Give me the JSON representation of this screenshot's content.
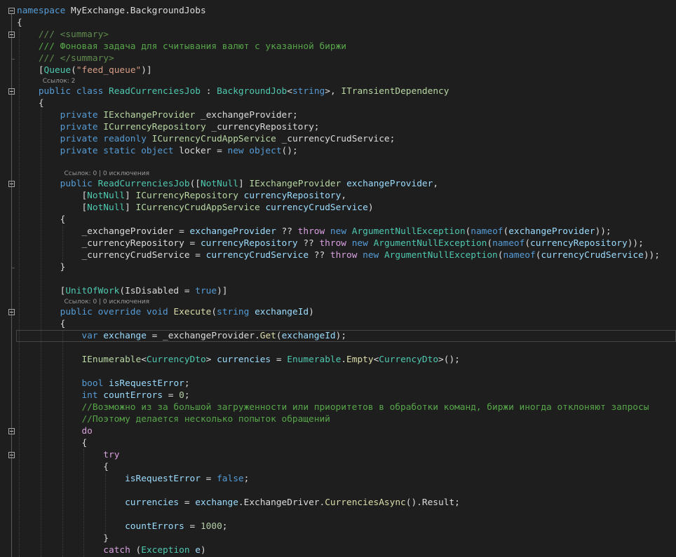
{
  "colors": {
    "background": "#1e1e1e",
    "keyword": "#569cd6",
    "control_keyword": "#d8a0df",
    "type": "#4ec9b0",
    "interface": "#b8d7a3",
    "comment": "#57a64a",
    "string": "#d69d85",
    "method": "#dcdcaa",
    "parameter": "#9cdcfe",
    "text": "#dcdcdc"
  },
  "code": {
    "lines": [
      [
        {
          "k": "kw",
          "t": "namespace"
        },
        {
          "k": "pl",
          "t": " MyExchange.BackgroundJobs"
        }
      ],
      [
        {
          "k": "pl",
          "t": "{"
        }
      ],
      [
        {
          "k": "pl",
          "t": "    "
        },
        {
          "k": "doc",
          "t": "/// <summary>"
        }
      ],
      [
        {
          "k": "pl",
          "t": "    "
        },
        {
          "k": "cm",
          "t": "/// Фоновая задача для считывания валют с указанной биржи"
        }
      ],
      [
        {
          "k": "pl",
          "t": "    "
        },
        {
          "k": "doc",
          "t": "/// </summary>"
        }
      ],
      [
        {
          "k": "pl",
          "t": "    ["
        },
        {
          "k": "ty",
          "t": "Queue"
        },
        {
          "k": "pl",
          "t": "("
        },
        {
          "k": "str",
          "t": "\"feed_queue\""
        },
        {
          "k": "pl",
          "t": ")]"
        }
      ],
      [
        {
          "k": "pl",
          "t": "    "
        },
        {
          "k": "kw",
          "t": "public class"
        },
        {
          "k": "pl",
          "t": " "
        },
        {
          "k": "ty",
          "t": "ReadCurrenciesJob"
        },
        {
          "k": "pl",
          "t": " : "
        },
        {
          "k": "ty",
          "t": "BackgroundJob"
        },
        {
          "k": "pl",
          "t": "<"
        },
        {
          "k": "kw",
          "t": "string"
        },
        {
          "k": "pl",
          "t": ">, "
        },
        {
          "k": "iface",
          "t": "ITransientDependency"
        }
      ],
      [
        {
          "k": "pl",
          "t": "    {"
        }
      ],
      [
        {
          "k": "pl",
          "t": "        "
        },
        {
          "k": "kw",
          "t": "private"
        },
        {
          "k": "pl",
          "t": " "
        },
        {
          "k": "iface",
          "t": "IExchangeProvider"
        },
        {
          "k": "pl",
          "t": " _exchangeProvider;"
        }
      ],
      [
        {
          "k": "pl",
          "t": "        "
        },
        {
          "k": "kw",
          "t": "private"
        },
        {
          "k": "pl",
          "t": " "
        },
        {
          "k": "iface",
          "t": "ICurrencyRepository"
        },
        {
          "k": "pl",
          "t": " _currencyRepository;"
        }
      ],
      [
        {
          "k": "pl",
          "t": "        "
        },
        {
          "k": "kw",
          "t": "private readonly"
        },
        {
          "k": "pl",
          "t": " "
        },
        {
          "k": "iface",
          "t": "ICurrencyCrudAppService"
        },
        {
          "k": "pl",
          "t": " _currencyCrudService;"
        }
      ],
      [
        {
          "k": "pl",
          "t": "        "
        },
        {
          "k": "kw",
          "t": "private static object"
        },
        {
          "k": "pl",
          "t": " locker = "
        },
        {
          "k": "kw",
          "t": "new object"
        },
        {
          "k": "pl",
          "t": "();"
        }
      ],
      [],
      [
        {
          "k": "pl",
          "t": "        "
        },
        {
          "k": "kw",
          "t": "public"
        },
        {
          "k": "pl",
          "t": " "
        },
        {
          "k": "ty",
          "t": "ReadCurrenciesJob"
        },
        {
          "k": "pl",
          "t": "(["
        },
        {
          "k": "ty",
          "t": "NotNull"
        },
        {
          "k": "pl",
          "t": "] "
        },
        {
          "k": "iface",
          "t": "IExchangeProvider"
        },
        {
          "k": "pl",
          "t": " "
        },
        {
          "k": "prm",
          "t": "exchangeProvider"
        },
        {
          "k": "pl",
          "t": ","
        }
      ],
      [
        {
          "k": "pl",
          "t": "            ["
        },
        {
          "k": "ty",
          "t": "NotNull"
        },
        {
          "k": "pl",
          "t": "] "
        },
        {
          "k": "iface",
          "t": "ICurrencyRepository"
        },
        {
          "k": "pl",
          "t": " "
        },
        {
          "k": "prm",
          "t": "currencyRepository"
        },
        {
          "k": "pl",
          "t": ","
        }
      ],
      [
        {
          "k": "pl",
          "t": "            ["
        },
        {
          "k": "ty",
          "t": "NotNull"
        },
        {
          "k": "pl",
          "t": "] "
        },
        {
          "k": "iface",
          "t": "ICurrencyCrudAppService"
        },
        {
          "k": "pl",
          "t": " "
        },
        {
          "k": "prm",
          "t": "currencyCrudService"
        },
        {
          "k": "pl",
          "t": ")"
        }
      ],
      [
        {
          "k": "pl",
          "t": "        {"
        }
      ],
      [
        {
          "k": "pl",
          "t": "            _exchangeProvider = "
        },
        {
          "k": "prm",
          "t": "exchangeProvider"
        },
        {
          "k": "pl",
          "t": " ?? "
        },
        {
          "k": "ctl",
          "t": "throw"
        },
        {
          "k": "pl",
          "t": " "
        },
        {
          "k": "kw",
          "t": "new"
        },
        {
          "k": "pl",
          "t": " "
        },
        {
          "k": "ty",
          "t": "ArgumentNullException"
        },
        {
          "k": "pl",
          "t": "("
        },
        {
          "k": "kw",
          "t": "nameof"
        },
        {
          "k": "pl",
          "t": "("
        },
        {
          "k": "prm",
          "t": "exchangeProvider"
        },
        {
          "k": "pl",
          "t": "));"
        }
      ],
      [
        {
          "k": "pl",
          "t": "            _currencyRepository = "
        },
        {
          "k": "prm",
          "t": "currencyRepository"
        },
        {
          "k": "pl",
          "t": " ?? "
        },
        {
          "k": "ctl",
          "t": "throw"
        },
        {
          "k": "pl",
          "t": " "
        },
        {
          "k": "kw",
          "t": "new"
        },
        {
          "k": "pl",
          "t": " "
        },
        {
          "k": "ty",
          "t": "ArgumentNullException"
        },
        {
          "k": "pl",
          "t": "("
        },
        {
          "k": "kw",
          "t": "nameof"
        },
        {
          "k": "pl",
          "t": "("
        },
        {
          "k": "prm",
          "t": "currencyRepository"
        },
        {
          "k": "pl",
          "t": "));"
        }
      ],
      [
        {
          "k": "pl",
          "t": "            _currencyCrudService = "
        },
        {
          "k": "prm",
          "t": "currencyCrudService"
        },
        {
          "k": "pl",
          "t": " ?? "
        },
        {
          "k": "ctl",
          "t": "throw"
        },
        {
          "k": "pl",
          "t": " "
        },
        {
          "k": "kw",
          "t": "new"
        },
        {
          "k": "pl",
          "t": " "
        },
        {
          "k": "ty",
          "t": "ArgumentNullException"
        },
        {
          "k": "pl",
          "t": "("
        },
        {
          "k": "kw",
          "t": "nameof"
        },
        {
          "k": "pl",
          "t": "("
        },
        {
          "k": "prm",
          "t": "currencyCrudService"
        },
        {
          "k": "pl",
          "t": "));"
        }
      ],
      [
        {
          "k": "pl",
          "t": "        }"
        }
      ],
      [],
      [
        {
          "k": "pl",
          "t": "        ["
        },
        {
          "k": "ty",
          "t": "UnitOfWork"
        },
        {
          "k": "pl",
          "t": "(IsDisabled = "
        },
        {
          "k": "kw",
          "t": "true"
        },
        {
          "k": "pl",
          "t": ")]"
        }
      ],
      [
        {
          "k": "pl",
          "t": "        "
        },
        {
          "k": "kw",
          "t": "public override void"
        },
        {
          "k": "pl",
          "t": " "
        },
        {
          "k": "fn",
          "t": "Execute"
        },
        {
          "k": "pl",
          "t": "("
        },
        {
          "k": "kw",
          "t": "string"
        },
        {
          "k": "pl",
          "t": " "
        },
        {
          "k": "prm",
          "t": "exchangeId"
        },
        {
          "k": "pl",
          "t": ")"
        }
      ],
      [
        {
          "k": "pl",
          "t": "        {"
        }
      ],
      [
        {
          "k": "pl",
          "t": "            "
        },
        {
          "k": "kw",
          "t": "var"
        },
        {
          "k": "pl",
          "t": " "
        },
        {
          "k": "prm",
          "t": "exchange"
        },
        {
          "k": "pl",
          "t": " = _exchangeProvider."
        },
        {
          "k": "fn",
          "t": "Get"
        },
        {
          "k": "pl",
          "t": "("
        },
        {
          "k": "prm",
          "t": "exchangeId"
        },
        {
          "k": "pl",
          "t": ");"
        }
      ],
      [],
      [
        {
          "k": "pl",
          "t": "            "
        },
        {
          "k": "iface",
          "t": "IEnumerable"
        },
        {
          "k": "pl",
          "t": "<"
        },
        {
          "k": "ty",
          "t": "CurrencyDto"
        },
        {
          "k": "pl",
          "t": "> "
        },
        {
          "k": "prm",
          "t": "currencies"
        },
        {
          "k": "pl",
          "t": " = "
        },
        {
          "k": "ty",
          "t": "Enumerable"
        },
        {
          "k": "pl",
          "t": "."
        },
        {
          "k": "fn",
          "t": "Empty"
        },
        {
          "k": "pl",
          "t": "<"
        },
        {
          "k": "ty",
          "t": "CurrencyDto"
        },
        {
          "k": "pl",
          "t": ">();"
        }
      ],
      [],
      [
        {
          "k": "pl",
          "t": "            "
        },
        {
          "k": "kw",
          "t": "bool"
        },
        {
          "k": "pl",
          "t": " "
        },
        {
          "k": "prm",
          "t": "isRequestError"
        },
        {
          "k": "pl",
          "t": ";"
        }
      ],
      [
        {
          "k": "pl",
          "t": "            "
        },
        {
          "k": "kw",
          "t": "int"
        },
        {
          "k": "pl",
          "t": " "
        },
        {
          "k": "prm",
          "t": "countErrors"
        },
        {
          "k": "pl",
          "t": " = "
        },
        {
          "k": "num",
          "t": "0"
        },
        {
          "k": "pl",
          "t": ";"
        }
      ],
      [
        {
          "k": "pl",
          "t": "            "
        },
        {
          "k": "cm",
          "t": "//Возможно из за большой загруженности или приоритетов в обработки команд, биржи иногда отклоняют запросы"
        }
      ],
      [
        {
          "k": "pl",
          "t": "            "
        },
        {
          "k": "cm",
          "t": "//Поэтому делается несколько попыток обращений"
        }
      ],
      [
        {
          "k": "pl",
          "t": "            "
        },
        {
          "k": "ctl",
          "t": "do"
        }
      ],
      [
        {
          "k": "pl",
          "t": "            {"
        }
      ],
      [
        {
          "k": "pl",
          "t": "                "
        },
        {
          "k": "ctl",
          "t": "try"
        }
      ],
      [
        {
          "k": "pl",
          "t": "                {"
        }
      ],
      [
        {
          "k": "pl",
          "t": "                    "
        },
        {
          "k": "prm",
          "t": "isRequestError"
        },
        {
          "k": "pl",
          "t": " = "
        },
        {
          "k": "kw",
          "t": "false"
        },
        {
          "k": "pl",
          "t": ";"
        }
      ],
      [],
      [
        {
          "k": "pl",
          "t": "                    "
        },
        {
          "k": "prm",
          "t": "currencies"
        },
        {
          "k": "pl",
          "t": " = "
        },
        {
          "k": "prm",
          "t": "exchange"
        },
        {
          "k": "pl",
          "t": ".ExchangeDriver."
        },
        {
          "k": "fn",
          "t": "CurrenciesAsync"
        },
        {
          "k": "pl",
          "t": "().Result;"
        }
      ],
      [],
      [
        {
          "k": "pl",
          "t": "                    "
        },
        {
          "k": "prm",
          "t": "countErrors"
        },
        {
          "k": "pl",
          "t": " = "
        },
        {
          "k": "num",
          "t": "1000"
        },
        {
          "k": "pl",
          "t": ";"
        }
      ],
      [
        {
          "k": "pl",
          "t": "                }"
        }
      ],
      [
        {
          "k": "pl",
          "t": "                "
        },
        {
          "k": "ctl",
          "t": "catch"
        },
        {
          "k": "pl",
          "t": " ("
        },
        {
          "k": "ty",
          "t": "Exception"
        },
        {
          "k": "pl",
          "t": " "
        },
        {
          "k": "prm",
          "t": "e"
        },
        {
          "k": "pl",
          "t": ")"
        }
      ]
    ],
    "codelens": [
      {
        "line": 6,
        "text": "Ссылок: 2"
      },
      {
        "line": 13,
        "text": "Ссылок: 0 | 0 исключения"
      },
      {
        "line": 23,
        "text": "Ссылок: 0 | 0 исключения"
      }
    ]
  }
}
